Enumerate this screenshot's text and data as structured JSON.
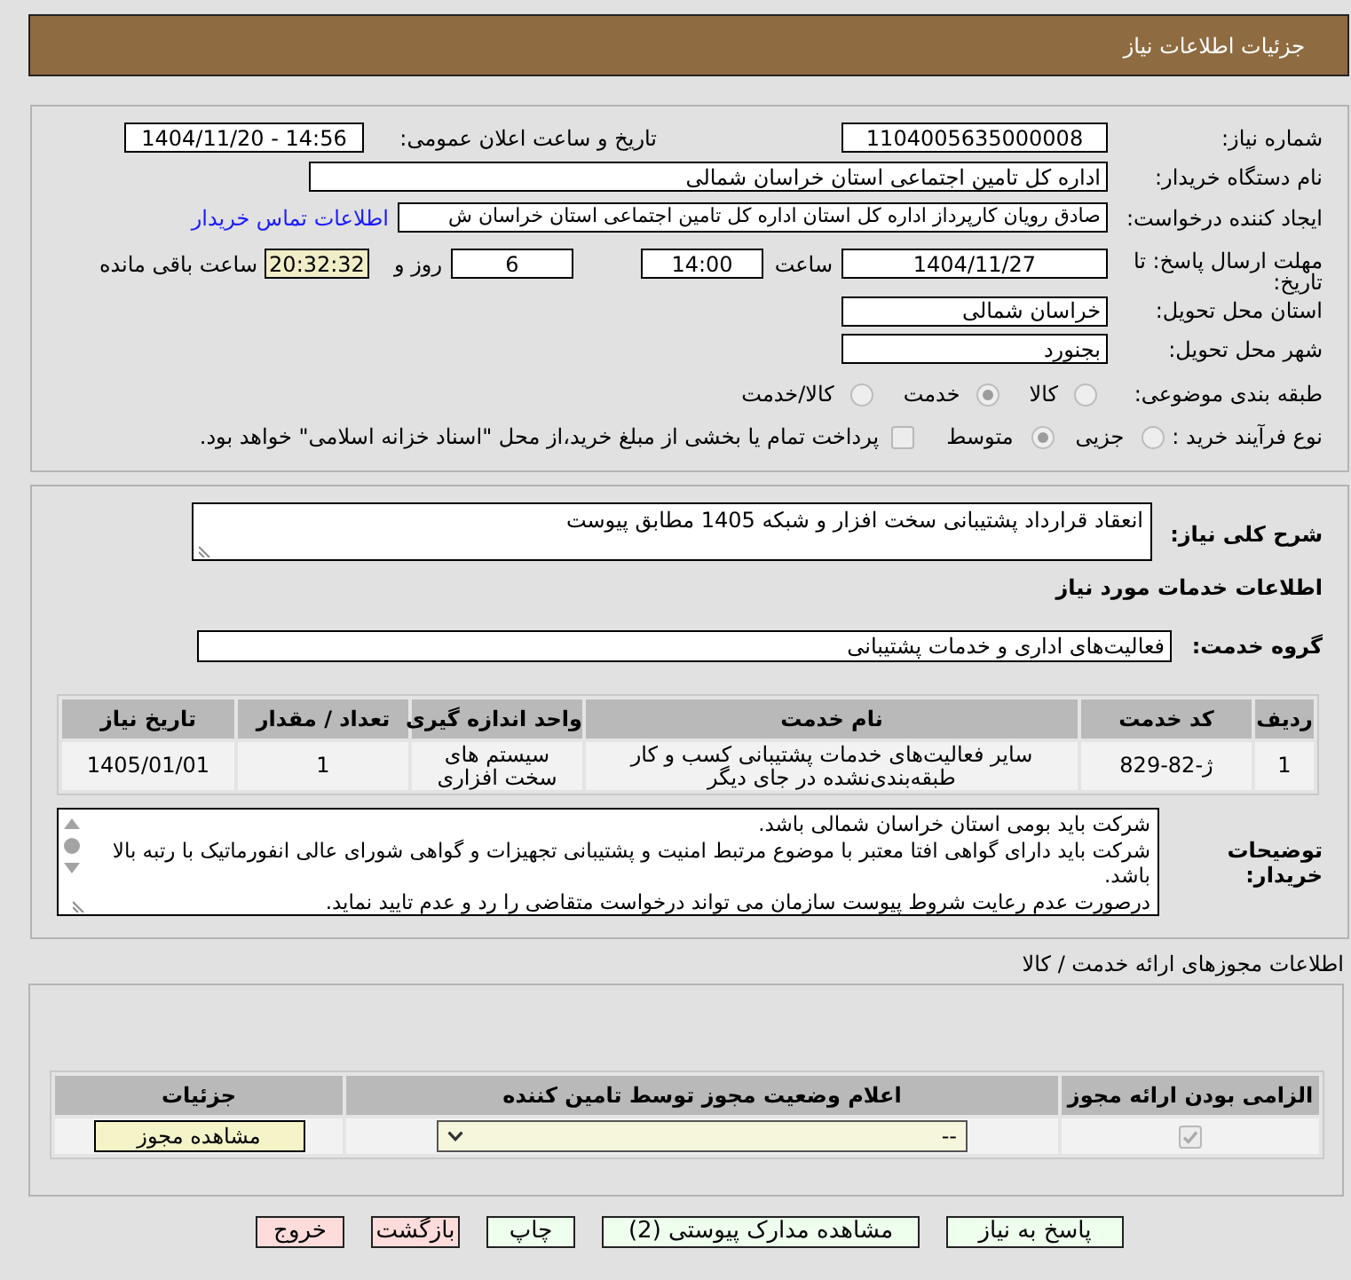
{
  "title_bar": {
    "title": "جزئیات اطلاعات نیاز"
  },
  "details": {
    "need_number": {
      "label": "شماره نیاز:",
      "value": "1104005635000008"
    },
    "announce_datetime": {
      "label": "تاریخ و ساعت اعلان عمومی:",
      "value": "1404/11/20 - 14:56"
    },
    "buyer_org": {
      "label": "نام دستگاه خریدار:",
      "value": "اداره کل تامین اجتماعی استان خراسان شمالی"
    },
    "requester": {
      "label": "ایجاد کننده درخواست:",
      "value": "صادق  رویان کارپرداز اداره کل استان اداره کل تامین اجتماعی استان خراسان ش",
      "contact_link": "اطلاعات تماس خریدار"
    },
    "deadline": {
      "label": "مهلت ارسال پاسخ: تا تاریخ:",
      "date": "1404/11/27",
      "time_label": "ساعت",
      "time": "14:00",
      "days": "6",
      "days_label": "روز و",
      "remaining": "20:32:32",
      "remaining_label": "ساعت باقی مانده"
    },
    "delivery_province": {
      "label": "استان محل تحویل:",
      "value": "خراسان شمالی"
    },
    "delivery_city": {
      "label": "شهر محل تحویل:",
      "value": "بجنورد"
    },
    "category": {
      "label": "طبقه بندی موضوعی:",
      "disabled": true,
      "options": [
        {
          "label": "کالا",
          "selected": false
        },
        {
          "label": "خدمت",
          "selected": true
        },
        {
          "label": "کالا/خدمت",
          "selected": false
        }
      ]
    },
    "purchase_type": {
      "label": "نوع فرآیند خرید :",
      "disabled": true,
      "options": [
        {
          "label": "جزیی",
          "selected": false
        },
        {
          "label": "متوسط",
          "selected": true
        }
      ],
      "treasury_option": {
        "label": "پرداخت تمام یا بخشی از مبلغ خرید،از محل \"اسناد خزانه اسلامی\" خواهد بود.",
        "checked": false,
        "disabled": true
      }
    }
  },
  "need": {
    "description": {
      "label": "شرح کلی نیاز:",
      "value": "انعقاد قرارداد پشتیبانی سخت افزار و شبکه 1405 مطابق پیوست"
    },
    "services_heading": "اطلاعات خدمات مورد نیاز",
    "service_group": {
      "label": "گروه خدمت:",
      "value": "فعالیت‌های اداری و خدمات پشتیبانی"
    },
    "services_table": {
      "columns": [
        "ردیف",
        "کد خدمت",
        "نام خدمت",
        "واحد اندازه گیری",
        "تعداد / مقدار",
        "تاریخ نیاز"
      ],
      "rows": [
        [
          "1",
          "ژ-82-829",
          "سایر فعالیت‌های خدمات پشتیبانی کسب و کار طبقه‌بندی‌نشده در جای دیگر",
          "سیستم های سخت افزاری",
          "1",
          "1405/01/01"
        ]
      ]
    },
    "buyer_notes": {
      "label": "توضیحات خریدار:",
      "lines": [
        "شرکت باید بومی استان خراسان شمالی باشد.",
        "شرکت باید دارای گواهی افتا معتبر با موضوع مرتبط امنیت و پشتیبانی تجهیزات و گواهی شورای عالی انفورماتیک با رتبه بالا باشد.",
        "درصورت عدم رعایت شروط پیوست سازمان می تواند درخواست متقاضی را رد و عدم تایید نماید."
      ]
    }
  },
  "licenses": {
    "title": "اطلاعات مجوزهای ارائه خدمت / کالا",
    "columns": [
      "الزامی بودن ارائه مجوز",
      "اعلام وضعیت مجوز توسط تامین کننده",
      "جزئیات"
    ],
    "rows": [
      {
        "required": true,
        "disabled": true,
        "status": "--",
        "details_button": "مشاهده مجوز"
      }
    ]
  },
  "buttons": [
    {
      "label": "پاسخ به نیاز",
      "kind": "confirm"
    },
    {
      "label": "مشاهده مدارک پیوستی (2)",
      "kind": "confirm"
    },
    {
      "label": "چاپ",
      "kind": "confirm"
    },
    {
      "label": "بازگشت",
      "kind": "cancel"
    },
    {
      "label": "خروج",
      "kind": "cancel"
    }
  ]
}
